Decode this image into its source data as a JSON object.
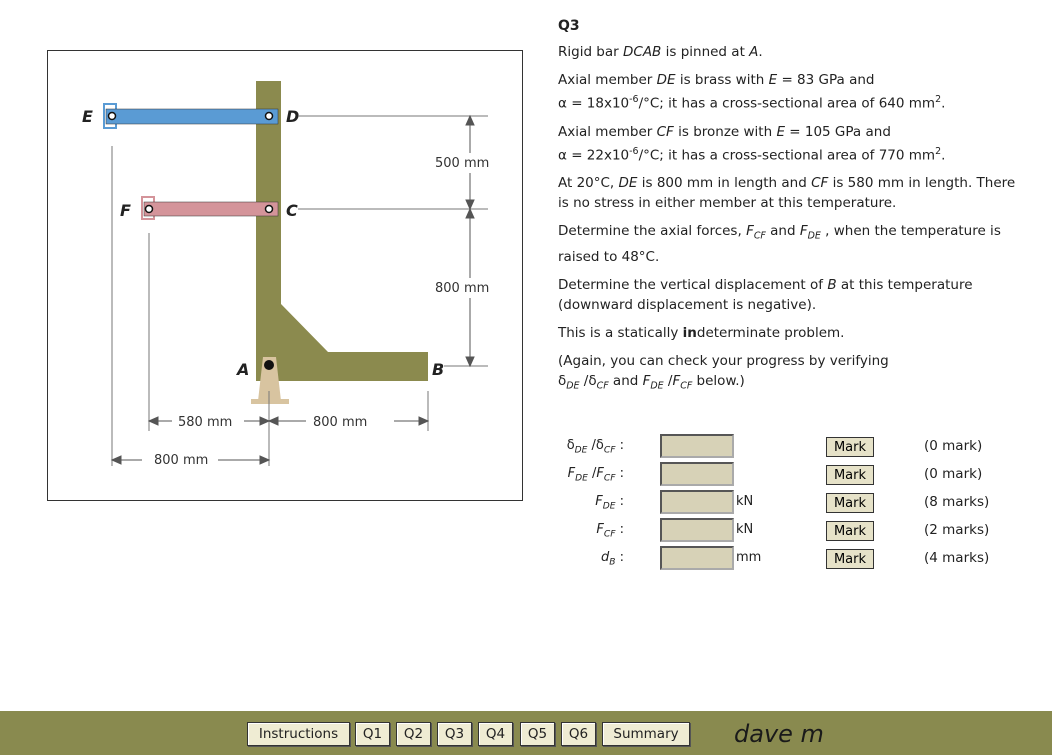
{
  "figure": {
    "points": {
      "E": "E",
      "D": "D",
      "F": "F",
      "C": "C",
      "A": "A",
      "B": "B"
    },
    "dims": {
      "d500": "500 mm",
      "d800v": "800 mm",
      "d580": "580 mm",
      "d800h": "800 mm",
      "d800b": "800 mm"
    }
  },
  "problem": {
    "title": "Q3",
    "p1_a": "Rigid bar ",
    "p1_bar": "DCAB",
    "p1_b": " is pinned at ",
    "p1_pin": "A",
    "p1_c": ".",
    "p2_a": "Axial member ",
    "p2_mem": "DE",
    "p2_b": "  is brass with ",
    "p2_E": "E",
    "p2_c": " = 83 GPa and",
    "p2_d": "α = 18x10",
    "p2_exp": "-6",
    "p2_e": "/°C; it has a cross-sectional area of 640 mm",
    "p2_sq": "2",
    "p2_f": ".",
    "p3_a": "Axial member ",
    "p3_mem": "CF",
    "p3_b": "  is bronze with ",
    "p3_E": "E",
    "p3_c": " = 105 GPa and",
    "p3_d": "α = 22x10",
    "p3_exp": "-6",
    "p3_e": "/°C; it has a cross-sectional area of 770 mm",
    "p3_sq": "2",
    "p3_f": ".",
    "p4_a": "At 20°C, ",
    "p4_de": "DE",
    "p4_b": "  is 800 mm in length and ",
    "p4_cf": "CF",
    "p4_c": "  is 580 mm in length. There is no stress in either member at this temperature.",
    "p5_a": "Determine the axial forces, ",
    "p5_f1": "F",
    "p5_s1": "CF",
    "p5_b": "  and ",
    "p5_f2": "F",
    "p5_s2": "DE",
    "p5_c": " , when the temperature is raised to 48°C.",
    "p6_a": "Determine the vertical displacement of ",
    "p6_b": "B",
    "p6_c": " at this temperature (downward displacement is negative).",
    "p7_a": "This is a statically ",
    "p7_bold": "in",
    "p7_b": "determinate problem.",
    "p8_a": "(Again, you can check your progress by verifying",
    "p8_d1": "δ",
    "p8_s1": "DE",
    "p8_sl1": " /",
    "p8_d2": "δ",
    "p8_s2": "CF",
    "p8_and": "  and ",
    "p8_f1": "F",
    "p8_s3": "DE",
    "p8_sl2": " /",
    "p8_f2": "F",
    "p8_s4": "CF",
    "p8_end": "  below.)"
  },
  "answers": [
    {
      "sym": "δ",
      "sub": "DE",
      "sep": " /",
      "sym2": "δ",
      "sub2": "CF",
      "colon": " :",
      "value": "",
      "unit": "",
      "mark_label": "Mark",
      "marks": "(0 mark)"
    },
    {
      "sym": "F",
      "sub": "DE",
      "sep": " /",
      "sym2": "F",
      "sub2": "CF",
      "colon": " :",
      "value": "",
      "unit": "",
      "mark_label": "Mark",
      "marks": "(0 mark)"
    },
    {
      "sym": "F",
      "sub": "DE",
      "sep": "",
      "sym2": "",
      "sub2": "",
      "colon": " :",
      "value": "",
      "unit": "kN",
      "mark_label": "Mark",
      "marks": "(8 marks)"
    },
    {
      "sym": "F",
      "sub": "CF",
      "sep": "",
      "sym2": "",
      "sub2": "",
      "colon": " :",
      "value": "",
      "unit": "kN",
      "mark_label": "Mark",
      "marks": "(2 marks)"
    },
    {
      "sym": "d",
      "sub": "B",
      "sep": "",
      "sym2": "",
      "sub2": "",
      "colon": " :",
      "value": "",
      "unit": "mm",
      "mark_label": "Mark",
      "marks": "(4 marks)"
    }
  ],
  "nav": {
    "buttons": [
      "Instructions",
      "Q1",
      "Q2",
      "Q3",
      "Q4",
      "Q5",
      "Q6",
      "Summary"
    ],
    "user": "dave m"
  },
  "colors": {
    "bar": "#8b8a4e",
    "brass": "#5a9bd4",
    "bronze": "#d4949a",
    "support": "#d8c4a0",
    "nav_bg": "#898a4f"
  }
}
